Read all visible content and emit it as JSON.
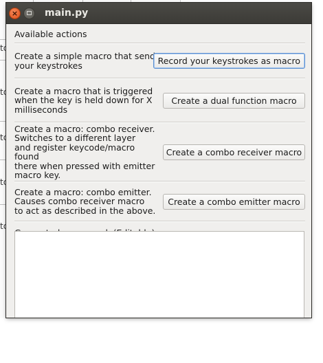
{
  "window": {
    "title": "main.py"
  },
  "background_window": {
    "fragments": [
      "tc",
      "tc",
      "tc",
      "tc",
      "tc"
    ]
  },
  "dialog": {
    "available_actions_label": "Available actions",
    "actions": [
      {
        "description": "Create a simple macro that sends\nyour keystrokes",
        "button_label": "Record your keystrokes as macro"
      },
      {
        "description": "Create a macro that is triggered\nwhen the key is held down for X\nmilliseconds",
        "button_label": "Create a dual function macro"
      },
      {
        "description": "Create a macro: combo receiver.\nSwitches to a different layer\nand register keycode/macro found\nthere when pressed with emitter\nmacro key.",
        "button_label": "Create a combo receiver macro"
      },
      {
        "description": "Create a macro: combo emitter.\nCauses combo receiver macro\nto act as described in the above.",
        "button_label": "Create a combo emitter macro"
      }
    ],
    "generated_code_label": "Generated macro code(Editable)",
    "generated_code_value": ""
  },
  "colors": {
    "titlebar": "#3c3b37",
    "close_button": "#dd4b14",
    "dialog_background": "#f0efed",
    "focus_border": "#5b8fd0"
  }
}
